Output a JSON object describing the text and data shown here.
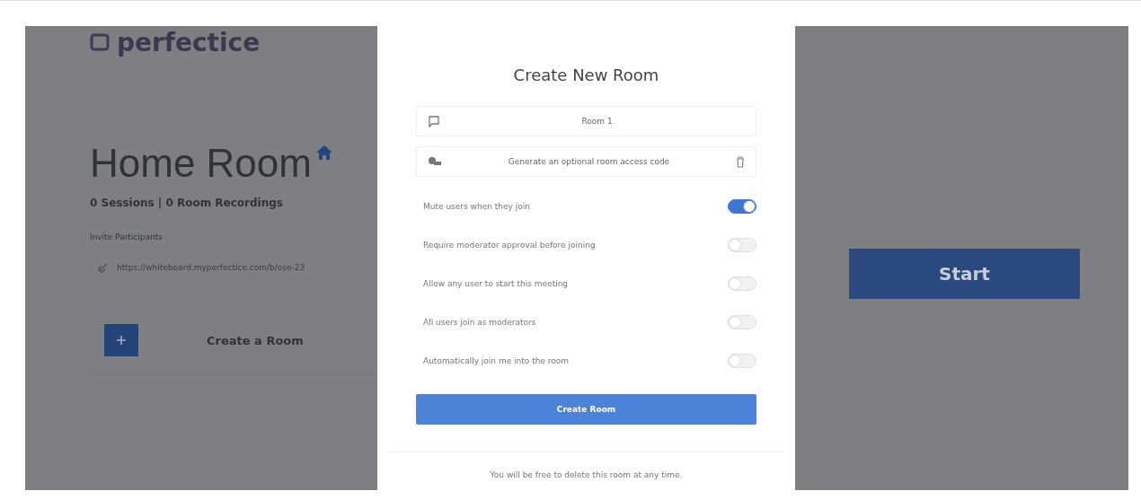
{
  "app": {
    "logo": "perfectice",
    "title": "Home Room",
    "stats": "0 Sessions | 0 Room Recordings",
    "invite_label": "Invite Participants",
    "invite_link": "https://whiteboard.myperfectice.com/b/ose-23",
    "create_room": "Create a Room",
    "start_button": "Start"
  },
  "modal": {
    "title": "Create New Room",
    "room_name": {
      "value": "Room 1"
    },
    "access_code": {
      "label": "Generate an optional room access code"
    },
    "settings": [
      {
        "label": "Mute users when they join",
        "on": true
      },
      {
        "label": "Require moderator approval before joining",
        "on": false
      },
      {
        "label": "Allow any user to start this meeting",
        "on": false
      },
      {
        "label": "All users join as moderators",
        "on": false
      },
      {
        "label": "Automatically join me into the room",
        "on": false
      }
    ],
    "submit": "Create Room",
    "footer": "You will be free to delete this room at any time."
  }
}
